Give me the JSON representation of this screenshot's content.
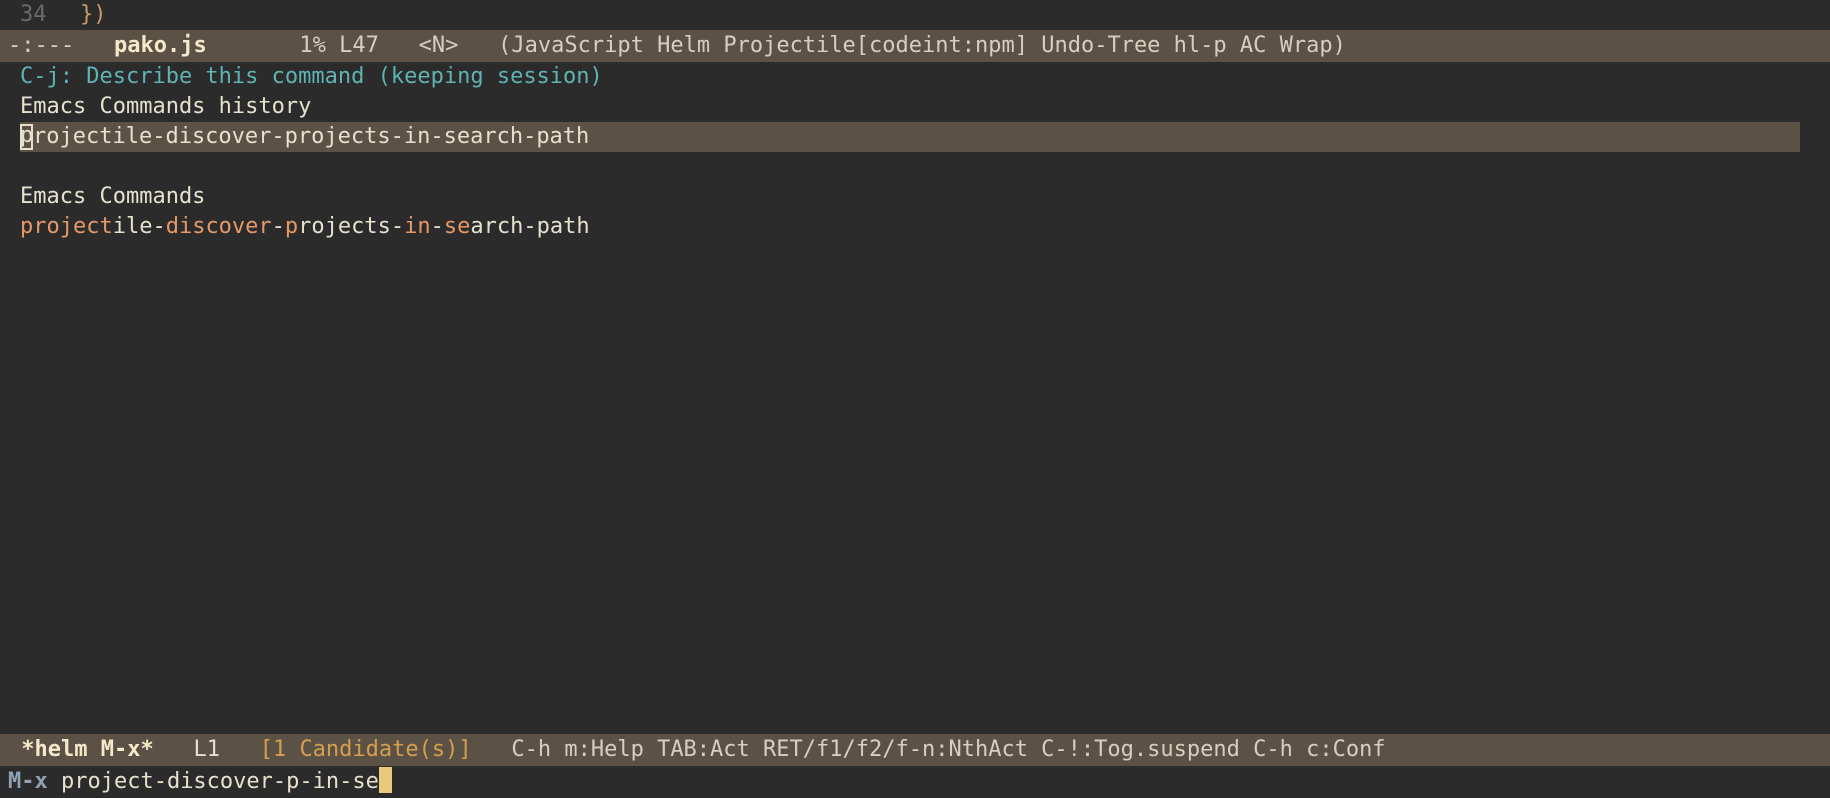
{
  "editor": {
    "line_number": "34",
    "code": "})"
  },
  "modeline_top": {
    "status": "-:--- ",
    "filename": "  pako.js",
    "gap1": "       ",
    "percent": "1% ",
    "line": "L47",
    "gap2": "   ",
    "mode_indicator": "<N>",
    "gap3": "   ",
    "modes": "(JavaScript Helm Projectile[codeint:npm] Undo-Tree hl-p AC Wrap)"
  },
  "helm": {
    "header": "C-j: Describe this command (keeping session)",
    "section1_title": "Emacs Commands history",
    "selected_candidate_tail": "rojectile-discover-projects-in-search-path",
    "section2_title": "Emacs Commands",
    "candidate_parts": [
      {
        "t": "project",
        "hl": true
      },
      {
        "t": "ile-",
        "hl": false
      },
      {
        "t": "discover",
        "hl": true
      },
      {
        "t": "-",
        "hl": false
      },
      {
        "t": "p",
        "hl": true
      },
      {
        "t": "rojects-",
        "hl": false
      },
      {
        "t": "in",
        "hl": true
      },
      {
        "t": "-",
        "hl": false
      },
      {
        "t": "se",
        "hl": true
      },
      {
        "t": "arch-path",
        "hl": false
      }
    ]
  },
  "modeline_helm": {
    "buffer": " *helm M-x*",
    "gap1": "   ",
    "pos": "L1",
    "gap2": "   ",
    "candidates": "[1 Candidate(s)]",
    "gap3": "   ",
    "help": "C-h m:Help TAB:Act RET/f1/f2/f-n:NthAct C-!:Tog.suspend C-h c:Conf"
  },
  "minibuffer": {
    "prompt": "M-x ",
    "input": "project-discover-p-in-se"
  }
}
